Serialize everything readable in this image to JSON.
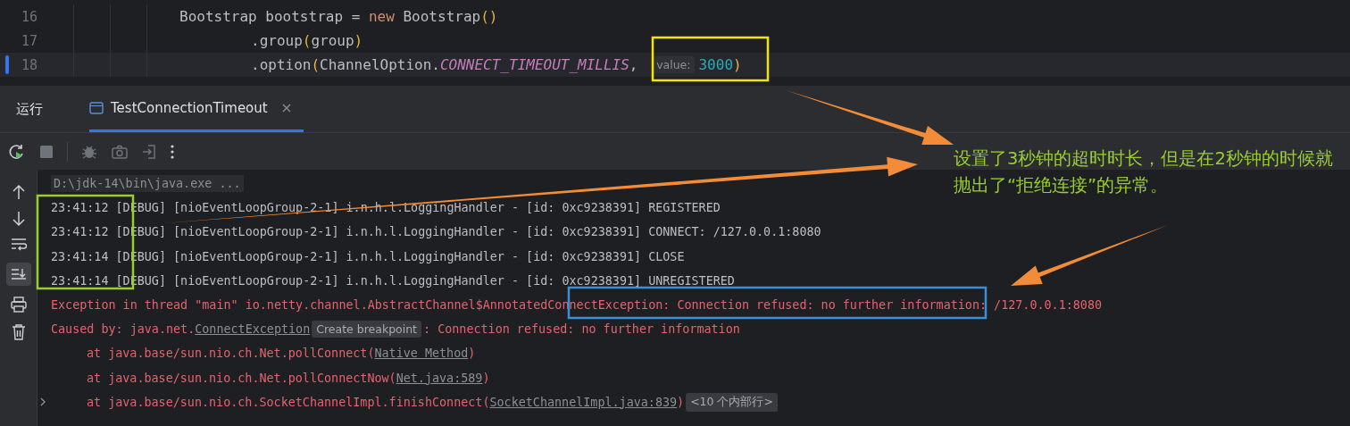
{
  "editor": {
    "lines": [
      {
        "number": "16",
        "current": false,
        "continuation": false,
        "tokens": [
          {
            "kind": "plain",
            "text": "Bootstrap bootstrap = "
          },
          {
            "kind": "keyword",
            "text": "new"
          },
          {
            "kind": "plain",
            "text": " Bootstrap"
          },
          {
            "kind": "paren",
            "text": "()"
          }
        ]
      },
      {
        "number": "17",
        "current": false,
        "continuation": true,
        "tokens": [
          {
            "kind": "plain",
            "text": ".group"
          },
          {
            "kind": "paren",
            "text": "("
          },
          {
            "kind": "plain",
            "text": "group"
          },
          {
            "kind": "paren",
            "text": ")"
          }
        ]
      },
      {
        "number": "18",
        "current": true,
        "continuation": true,
        "tokens": [
          {
            "kind": "plain",
            "text": ".option"
          },
          {
            "kind": "paren",
            "text": "("
          },
          {
            "kind": "plain",
            "text": "ChannelOption."
          },
          {
            "kind": "constant",
            "text": "CONNECT_TIMEOUT_MILLIS"
          },
          {
            "kind": "plain",
            "text": ", "
          },
          {
            "kind": "hint",
            "text": "value:"
          },
          {
            "kind": "number",
            "text": "3000"
          },
          {
            "kind": "paren",
            "text": ")"
          }
        ]
      }
    ]
  },
  "run_panel": {
    "title": "运行",
    "tabs": [
      {
        "label": "TestConnectionTimeout",
        "selected": true,
        "closable": true
      }
    ]
  },
  "console": {
    "lines": [
      {
        "kind": "command",
        "foldable": false,
        "segments": [
          {
            "kind": "text",
            "text": "D:\\jdk-14\\bin\\java.exe ..."
          }
        ]
      },
      {
        "kind": "log",
        "foldable": false,
        "segments": [
          {
            "kind": "text",
            "text": "23:41:12 [DEBUG] [nioEventLoopGroup-2-1] i.n.h.l.LoggingHandler - [id: 0xc9238391] REGISTERED"
          }
        ]
      },
      {
        "kind": "log",
        "foldable": false,
        "segments": [
          {
            "kind": "text",
            "text": "23:41:12 [DEBUG] [nioEventLoopGroup-2-1] i.n.h.l.LoggingHandler - [id: 0xc9238391] CONNECT: /127.0.0.1:8080"
          }
        ]
      },
      {
        "kind": "log",
        "foldable": false,
        "segments": [
          {
            "kind": "text",
            "text": "23:41:14 [DEBUG] [nioEventLoopGroup-2-1] i.n.h.l.LoggingHandler - [id: 0xc9238391] CLOSE"
          }
        ]
      },
      {
        "kind": "log",
        "foldable": false,
        "segments": [
          {
            "kind": "text",
            "text": "23:41:14 [DEBUG] [nioEventLoopGroup-2-1] i.n.h.l.LoggingHandler - [id: 0xc9238391] UNREGISTERED"
          }
        ]
      },
      {
        "kind": "error",
        "foldable": false,
        "segments": [
          {
            "kind": "text",
            "text": "Exception in thread \"main\" io.netty.channel.AbstractChannel$AnnotatedConnectException: Connection refused: no further information: /127.0.0.1:8080"
          }
        ]
      },
      {
        "kind": "error",
        "foldable": false,
        "segments": [
          {
            "kind": "text",
            "text": "Caused by: java.net."
          },
          {
            "kind": "link",
            "text": "ConnectException"
          },
          {
            "kind": "hint",
            "text": "Create breakpoint"
          },
          {
            "kind": "text",
            "text": ": Connection refused: no further information"
          }
        ]
      },
      {
        "kind": "stack",
        "foldable": false,
        "segments": [
          {
            "kind": "text",
            "text": "at java.base/sun.nio.ch.Net.pollConnect("
          },
          {
            "kind": "link",
            "text": "Native Method"
          },
          {
            "kind": "text",
            "text": ")"
          }
        ]
      },
      {
        "kind": "stack",
        "foldable": false,
        "segments": [
          {
            "kind": "text",
            "text": "at java.base/sun.nio.ch.Net.pollConnectNow("
          },
          {
            "kind": "link",
            "text": "Net.java:589"
          },
          {
            "kind": "text",
            "text": ")"
          }
        ]
      },
      {
        "kind": "stack",
        "foldable": true,
        "segments": [
          {
            "kind": "text",
            "text": "at java.base/sun.nio.ch.SocketChannelImpl.finishConnect("
          },
          {
            "kind": "link",
            "text": "SocketChannelImpl.java:839"
          },
          {
            "kind": "text",
            "text": ")"
          },
          {
            "kind": "hint",
            "text": "<10 个内部行>"
          }
        ]
      }
    ]
  },
  "annotation": {
    "note": "设置了3秒钟的超时时长，但是在2秒钟的时候就抛出了“拒绝连接”的异常。",
    "highlight_boxes": [
      {
        "color": "#f2e600"
      },
      {
        "color": "#9acd32"
      },
      {
        "color": "#3a8fd9"
      }
    ]
  }
}
